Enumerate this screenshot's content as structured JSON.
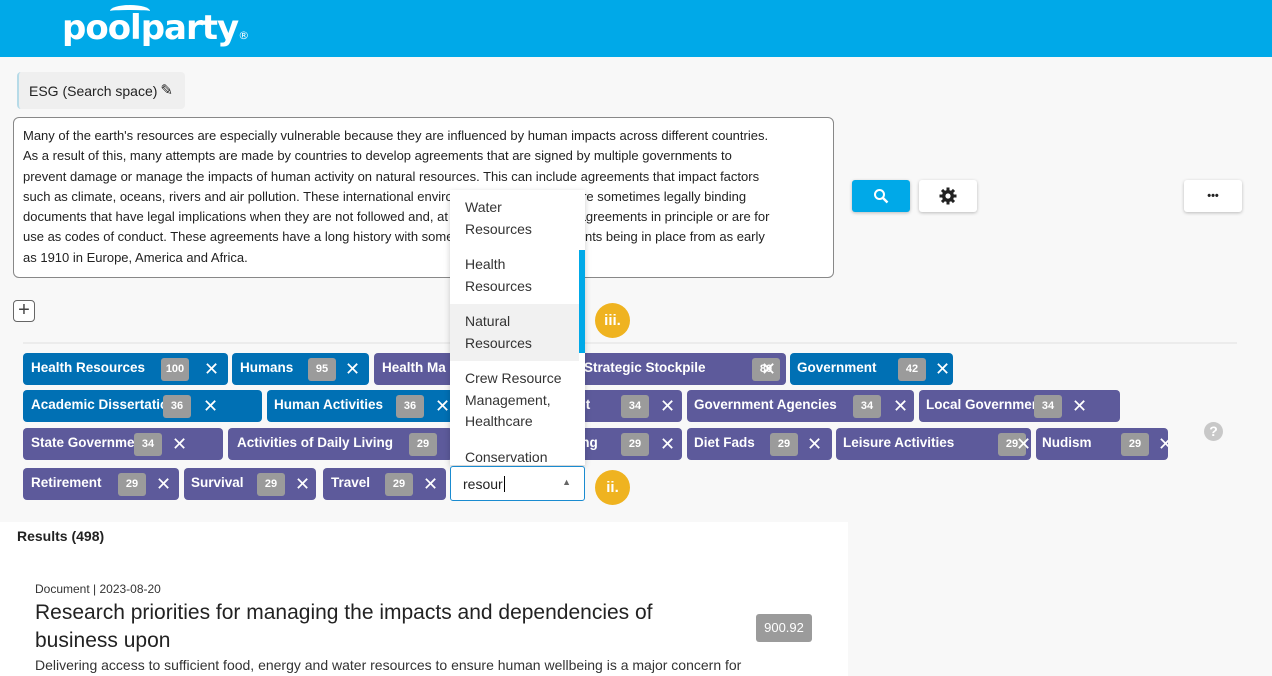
{
  "header": {
    "logo": "poolparty",
    "logo_mark": "®"
  },
  "search_space": {
    "label": "ESG (Search space)",
    "edit_icon": "pencil-icon"
  },
  "query": {
    "lines": [
      "Many of the earth's resources are especially vulnerable because they are influenced by human impacts across different countries.",
      "As a result of this, many attempts are made by countries to develop agreements that are signed by multiple governments to",
      "prevent damage or manage the impacts of human activity on natural resources. This can include agreements that impact factors",
      "such as climate, oceans, rivers and air pollution. These international environmental agreements are sometimes legally binding",
      "documents that have legal implications when they are not followed and, at other times, are more agreements in principle or are for",
      "use as codes of conduct. These agreements have a long history with some multinational agreements being in place from as early",
      "as 1910 in Europe, America and Africa."
    ]
  },
  "toolbar": {
    "search_icon": "search-icon",
    "settings_icon": "gear-icon",
    "more_icon": "more-icon",
    "more_label": "•••",
    "add_label": "+"
  },
  "chips": [
    {
      "label": "Health Resources",
      "count": "100",
      "color": "#0070b4"
    },
    {
      "label": "Humans",
      "count": "95",
      "color": "#0070b4"
    },
    {
      "label": "Health Ma",
      "count": "",
      "color": "#5d5a9b"
    },
    {
      "label": "Strategic Stockpile",
      "count": "80",
      "color": "#5d5a9b"
    },
    {
      "label": "Government",
      "count": "42",
      "color": "#0070b4"
    },
    {
      "label": "Academic Dissertations",
      "count": "36",
      "color": "#0070b4"
    },
    {
      "label": "Human Activities",
      "count": "36",
      "color": "#0070b4"
    },
    {
      "label": "ent",
      "count": "34",
      "color": "#5d5a9b"
    },
    {
      "label": "Government Agencies",
      "count": "34",
      "color": "#5d5a9b"
    },
    {
      "label": "Local Government",
      "count": "34",
      "color": "#5d5a9b"
    },
    {
      "label": "State Government",
      "count": "34",
      "color": "#5d5a9b"
    },
    {
      "label": "Activities of Daily Living",
      "count": "29",
      "color": "#5d5a9b"
    },
    {
      "label": "ving",
      "count": "29",
      "color": "#5d5a9b"
    },
    {
      "label": "Diet Fads",
      "count": "29",
      "color": "#5d5a9b"
    },
    {
      "label": "Leisure Activities",
      "count": "29",
      "color": "#5d5a9b"
    },
    {
      "label": "Nudism",
      "count": "29",
      "color": "#5d5a9b"
    },
    {
      "label": "Retirement",
      "count": "29",
      "color": "#5d5a9b"
    },
    {
      "label": "Survival",
      "count": "29",
      "color": "#5d5a9b"
    },
    {
      "label": "Travel",
      "count": "29",
      "color": "#5d5a9b"
    }
  ],
  "concept_input": {
    "value": "resour"
  },
  "dropdown": {
    "options": [
      "Water Resources",
      "Health Resources",
      "Natural Resources",
      "Crew Resource Management, Healthcare",
      "Conservation"
    ],
    "highlighted": "Natural Resources"
  },
  "annotations": {
    "iii": "iii.",
    "ii": "ii."
  },
  "help": "?",
  "results": {
    "heading": "Results (498)",
    "items": [
      {
        "meta": "Document | 2023-08-20",
        "title": "Research priorities for managing the impacts and dependencies of business upon",
        "score": "900.92",
        "snippet": "Delivering access to sufficient food, energy and water resources to ensure human wellbeing is a major concern for"
      }
    ]
  }
}
